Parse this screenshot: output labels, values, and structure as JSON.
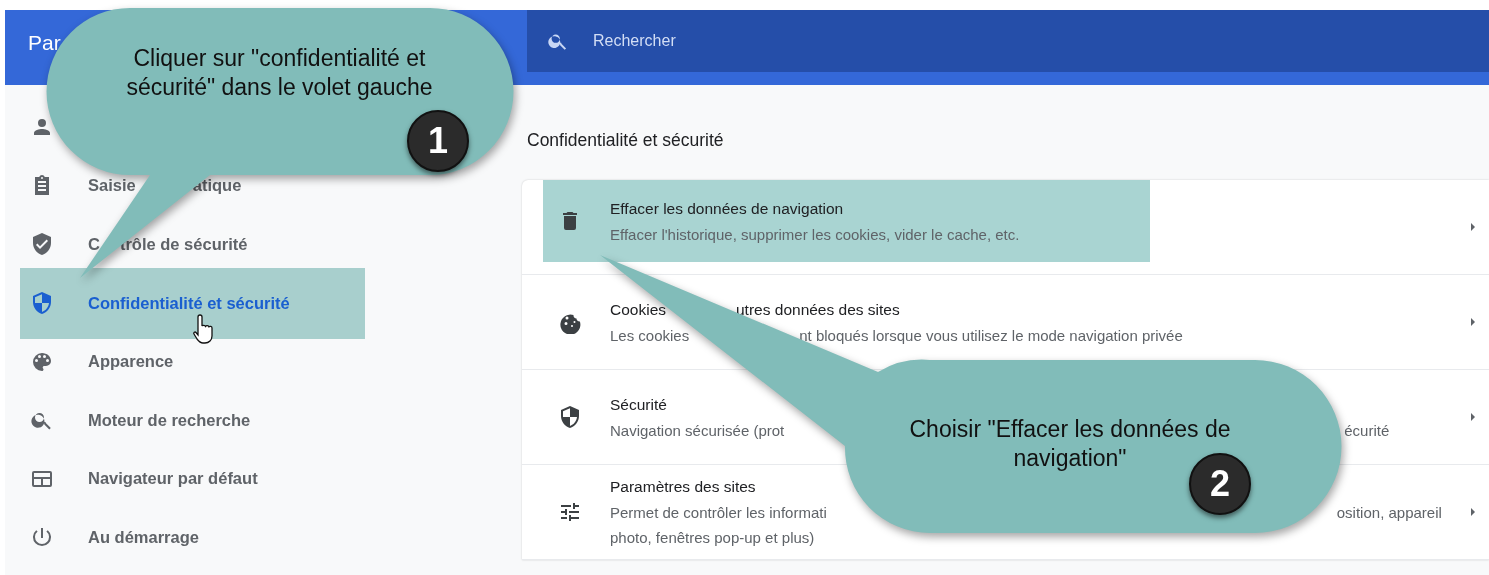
{
  "header": {
    "title": "Par",
    "search": {
      "placeholder": "Rechercher"
    }
  },
  "sidebar": {
    "items": [
      {
        "selected": false
      },
      {
        "selected": false,
        "label": [
          "Saisie",
          "atique"
        ]
      },
      {
        "selected": false,
        "label": [
          "C",
          "trôle de sécurité"
        ]
      },
      {
        "selected": true,
        "label": [
          "Confidentialité et sécurité"
        ]
      },
      {
        "selected": false,
        "label": [
          "Apparence"
        ]
      },
      {
        "selected": false,
        "label": [
          "Moteur de recherche"
        ]
      },
      {
        "selected": false,
        "label": [
          "Navigateur par défaut"
        ]
      },
      {
        "selected": false,
        "label": [
          "Au démarrage"
        ]
      }
    ]
  },
  "main": {
    "heading": "Confidentialité et sécurité",
    "rows": [
      {
        "selected": true,
        "title": [
          "Effacer les données de navigation"
        ],
        "description": [
          [
            "Effacer l'historique, supprimer les cookies, vider le cache, etc."
          ]
        ]
      },
      {
        "selected": false,
        "title": [
          "Cookies",
          "utres données des sites"
        ],
        "description": [
          [
            "Les cookies",
            "nt bloqués lorsque vous utilisez le mode navigation privée"
          ]
        ]
      },
      {
        "selected": false,
        "title": [
          "Sécurité"
        ],
        "description": [
          [
            "Navigation sécurisée (prot",
            "écurité"
          ]
        ]
      },
      {
        "selected": false,
        "title": [
          "Paramètres des sites"
        ],
        "description": [
          [
            "Permet de contrôler les informati",
            "osition, appareil"
          ],
          [
            "photo, fenêtres pop-up et plus)"
          ]
        ]
      }
    ]
  },
  "callouts": [
    {
      "text": "Cliquer sur \"confidentialité et sécurité\" dans le volet gauche",
      "number": "1"
    },
    {
      "text": "Choisir \"Effacer les données de navigation\"",
      "number": "2"
    }
  ]
}
